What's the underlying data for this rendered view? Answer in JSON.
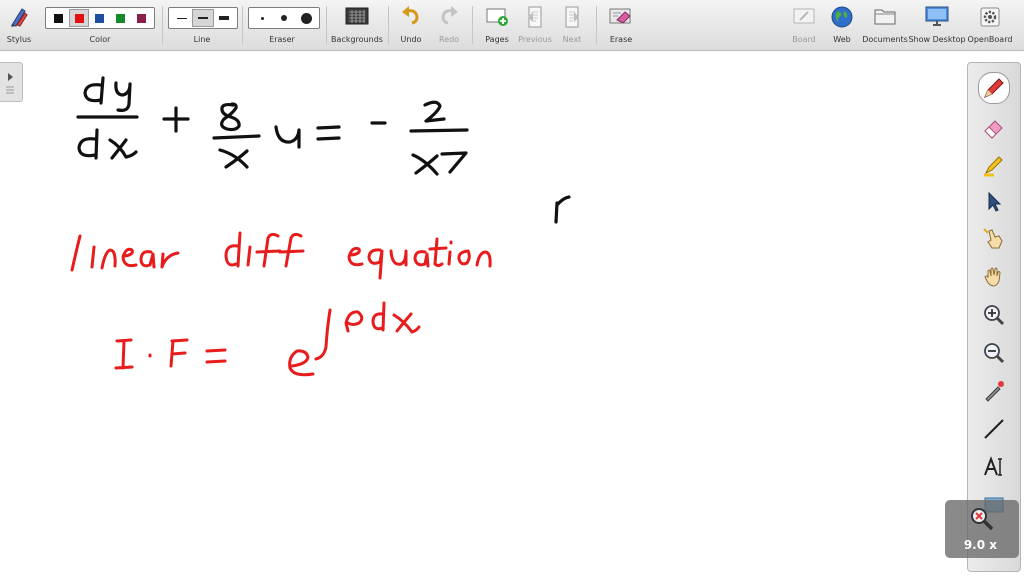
{
  "toolbar": {
    "stylus": "Stylus",
    "color": "Color",
    "line": "Line",
    "eraser": "Eraser",
    "backgrounds": "Backgrounds",
    "undo": "Undo",
    "redo": "Redo",
    "pages": "Pages",
    "previous": "Previous",
    "next": "Next",
    "erase": "Erase",
    "board": "Board",
    "web": "Web",
    "documents": "Documents",
    "show_desktop": "Show Desktop",
    "openboard": "OpenBoard",
    "colors": [
      "#111111",
      "#e31010",
      "#1f4f9e",
      "#158a2b",
      "#8a1f4e"
    ],
    "selected_color_index": 1
  },
  "zoom": {
    "label": "9.0 x"
  },
  "colors": {
    "ink_black": "#111111",
    "ink_red": "#e81c1c"
  }
}
